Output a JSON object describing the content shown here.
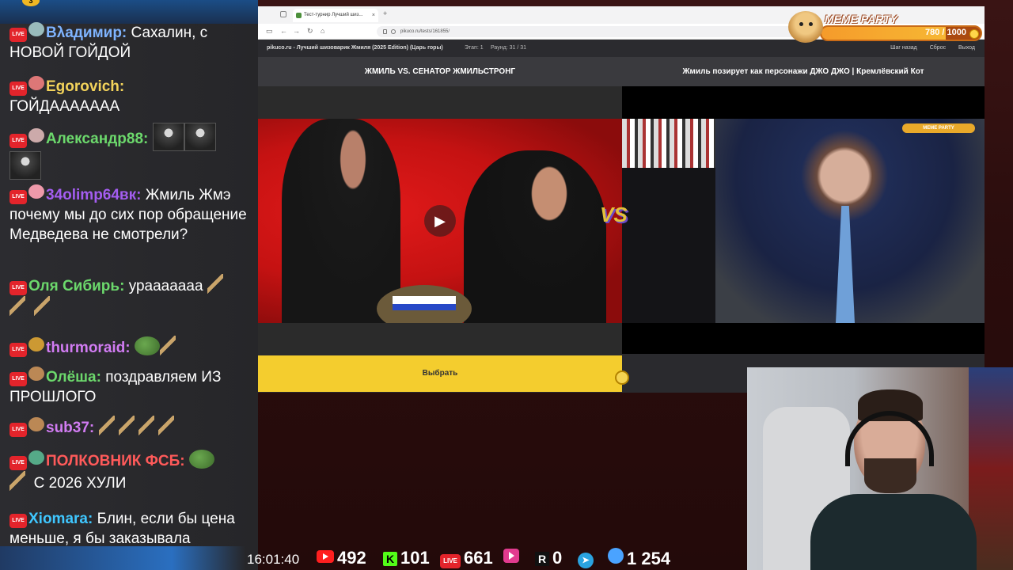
{
  "chat": {
    "live_badge": "LIVE",
    "badge_count": "3",
    "messages": [
      {
        "nick": "Вλадимир:",
        "nick_color": "#7fb4ff",
        "text": "Сахалин, с НОВОЙ ГОЙДОЙ"
      },
      {
        "nick": "Egorovich:",
        "nick_color": "#f3d35b",
        "text": "ГОЙДААААААА"
      },
      {
        "nick": "Александр88:",
        "nick_color": "#6cd96c",
        "text": ""
      },
      {
        "nick": "34olimp64вк:",
        "nick_color": "#a45df0",
        "text": "Жмиль Жмэ почему мы до сих пор обращение Медведева не смотрели?"
      },
      {
        "nick": "Оля Сибирь:",
        "nick_color": "#6cd96c",
        "text": "ураааааaa"
      },
      {
        "nick": "thurmoraid:",
        "nick_color": "#d27cf3",
        "text": ""
      },
      {
        "nick": "Олёша:",
        "nick_color": "#6cd96c",
        "text": "поздравляем ИЗ ПРОШЛОГО"
      },
      {
        "nick": "sub37:",
        "nick_color": "#d27cf3",
        "text": ""
      },
      {
        "nick": "ПОЛКОВНИК ФСБ:",
        "nick_color": "#ff5a5a",
        "text": "С 2026 ХУЛИ"
      },
      {
        "nick": "Xiomara:",
        "nick_color": "#3fc7ff",
        "text": "Блин, если бы цена меньше, я бы заказывала"
      }
    ]
  },
  "browser": {
    "tab_title": "Тест-турнир Лучший шиз...",
    "new_tab": "+",
    "url": "pikuco.ru/tests/161855/",
    "site_title": "pikuco.ru - Лучший шизоварик Жмиля (2025 Edition) (Царь горы)",
    "stage": "Этап: 1",
    "round": "Раунд: 31 / 31",
    "back_label": "Шаг назад",
    "reset_label": "Сброс",
    "exit_label": "Выход",
    "left_title": "ЖМИЛЬ VS. СЕНАТОР ЖМИЛЬСТРОНГ",
    "right_title": "Жмиль позирует как персонажи ДЖО ДЖО | Кремлёвский Кот",
    "choose_label": "Выбрать",
    "vs_label": "VS",
    "overlay_logo": "MEME PARTY"
  },
  "meme_party": {
    "name": "MEME PARTY",
    "value": "780 / 1000",
    "progress": 0.78
  },
  "stats": {
    "time": "16:01:40",
    "youtube": "492",
    "kick": "101",
    "vk_live": "661",
    "vk_video": "",
    "rutube": "0",
    "telegram": "",
    "twitch": "1 254"
  },
  "colors": {
    "accent_yellow": "#f4cd2e",
    "live_red": "#e3242b",
    "meme_orange": "#f59b2b"
  }
}
